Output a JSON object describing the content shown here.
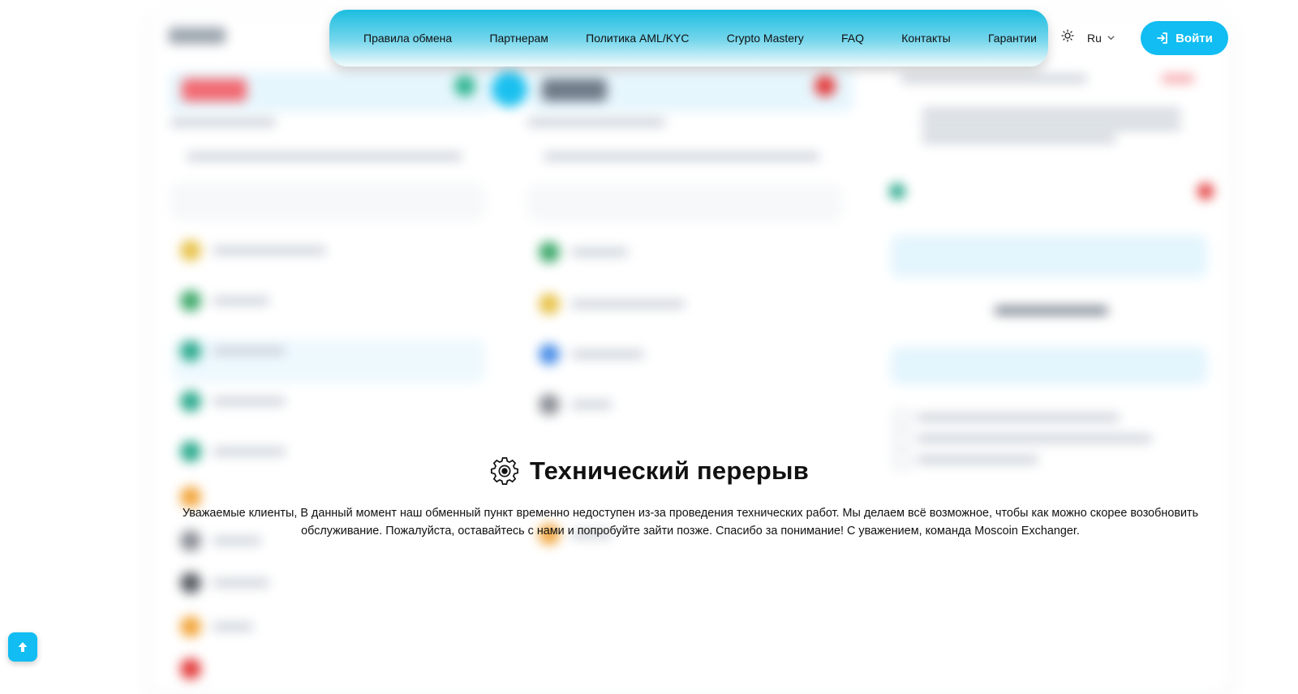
{
  "nav": {
    "items": [
      "Правила обмена",
      "Партнерам",
      "Политика AML/KYC",
      "Crypto Mastery",
      "FAQ",
      "Контакты",
      "Гарантии"
    ]
  },
  "header": {
    "theme_icon": "sun-icon",
    "language": "Ru",
    "login_label": "Войти",
    "login_icon": "login-arrow-icon"
  },
  "maintenance": {
    "icon": "gear-icon",
    "title": "Технический перерыв",
    "message": "Уважаемые клиенты, В данный момент наш обменный пункт временно недоступен из-за проведения технических работ. Мы делаем всё возможное, чтобы как можно скорее возобновить обслуживание. Пожалуйста, оставайтесь с нами и попробуйте зайти позже. Спасибо за понимание! С уважением, команда Moscoin Exchanger."
  },
  "scroll_top": {
    "icon": "arrow-up-icon"
  },
  "colors": {
    "accent": "#11bdf2",
    "nav_top": "#1bbde0"
  }
}
